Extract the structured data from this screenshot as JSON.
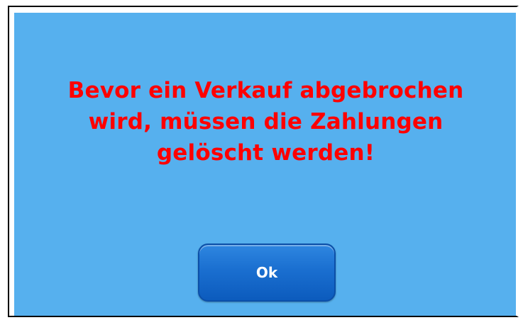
{
  "dialog": {
    "message_lines": [
      "Bevor ein Verkauf abgebrochen",
      "wird, müssen die Zahlungen",
      "gelöscht werden!"
    ],
    "ok_label": "Ok"
  },
  "colors": {
    "background": "#56b0ee",
    "message_text": "#ff0000",
    "button": "#1a6fd0",
    "button_text": "#ffffff"
  }
}
